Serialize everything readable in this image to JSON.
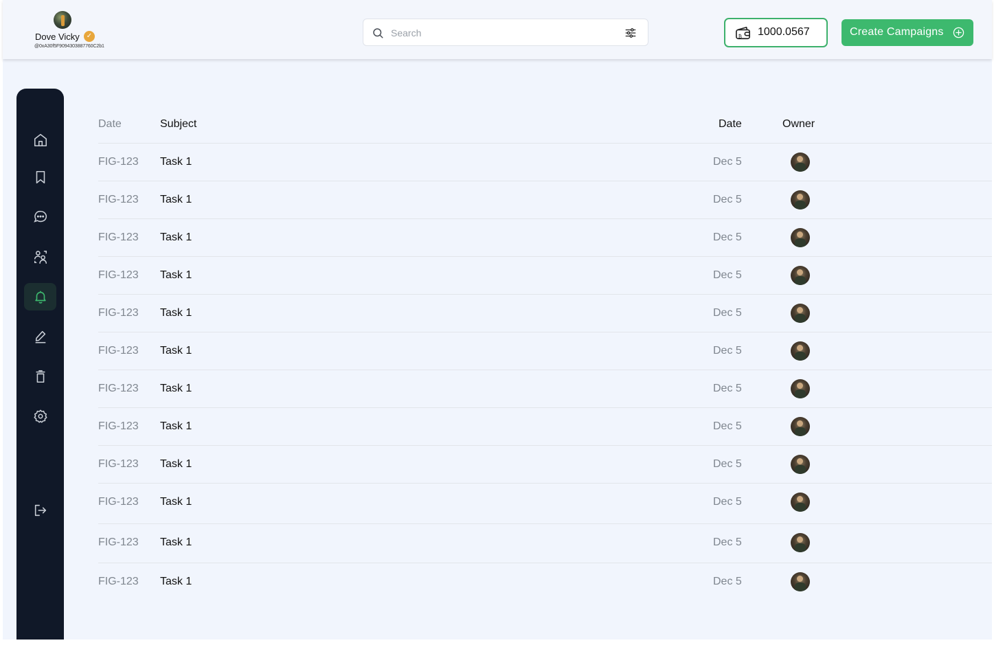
{
  "header": {
    "profile": {
      "name": "Dove Vicky",
      "handle": "@0xA30f5F9094303887760C2b1"
    },
    "search": {
      "placeholder": "Search"
    },
    "balance": "1000.0567",
    "create_button": "Create Campaigns"
  },
  "sidebar": {
    "items": [
      {
        "icon": "home-icon",
        "active": false
      },
      {
        "icon": "bookmark-icon",
        "active": false
      },
      {
        "icon": "chat-icon",
        "active": false
      },
      {
        "icon": "users-icon",
        "active": false
      },
      {
        "icon": "bell-icon",
        "active": true
      },
      {
        "icon": "edit-icon",
        "active": false
      },
      {
        "icon": "trash-icon",
        "active": false
      },
      {
        "icon": "gear-icon",
        "active": false
      }
    ],
    "logout_icon": "logout-icon",
    "accent_color": "#3db96e"
  },
  "table": {
    "headers": [
      "Date",
      "Subject",
      "Date",
      "Owner"
    ],
    "rows": [
      {
        "id": "FIG-123",
        "subject": "Task 1",
        "date": "Dec 5"
      },
      {
        "id": "FIG-123",
        "subject": "Task 1",
        "date": "Dec 5"
      },
      {
        "id": "FIG-123",
        "subject": "Task 1",
        "date": "Dec 5"
      },
      {
        "id": "FIG-123",
        "subject": "Task 1",
        "date": "Dec 5"
      },
      {
        "id": "FIG-123",
        "subject": "Task 1",
        "date": "Dec 5"
      },
      {
        "id": "FIG-123",
        "subject": "Task 1",
        "date": "Dec 5"
      },
      {
        "id": "FIG-123",
        "subject": "Task 1",
        "date": "Dec 5"
      },
      {
        "id": "FIG-123",
        "subject": "Task 1",
        "date": "Dec 5"
      },
      {
        "id": "FIG-123",
        "subject": "Task 1",
        "date": "Dec 5"
      },
      {
        "id": "FIG-123",
        "subject": "Task 1",
        "date": "Dec 5"
      },
      {
        "id": "FIG-123",
        "subject": "Task 1",
        "date": "Dec 5"
      },
      {
        "id": "FIG-123",
        "subject": "Task 1",
        "date": "Dec 5"
      }
    ]
  }
}
